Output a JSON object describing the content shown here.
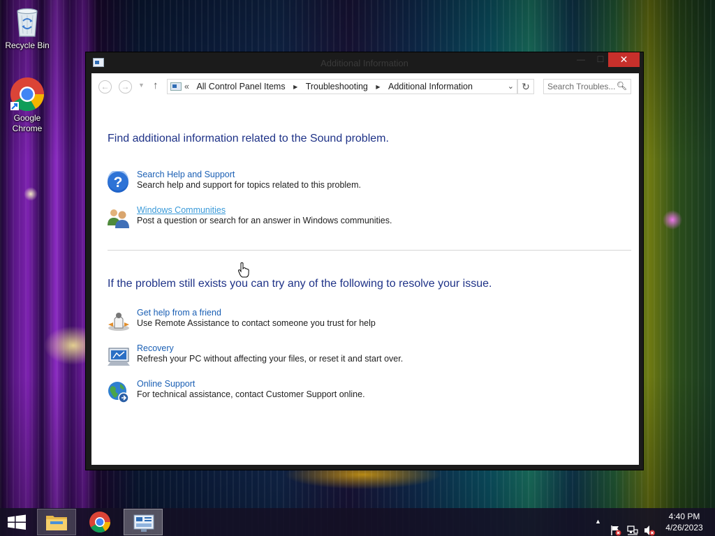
{
  "desktop": {
    "icons": [
      {
        "label": "Recycle Bin",
        "icon": "recycle-bin-icon"
      },
      {
        "label": "Google\nChrome",
        "icon": "chrome-icon"
      }
    ]
  },
  "window": {
    "title": "Additional Information",
    "close_glyph": "✕",
    "min_glyph": "—",
    "max_glyph": "☐"
  },
  "nav": {
    "back_glyph": "←",
    "forward_glyph": "→",
    "recent_glyph": "▼",
    "up_glyph": "↑",
    "lead": "«",
    "breadcrumbs": [
      "All Control Panel Items",
      "Troubleshooting",
      "Additional Information"
    ],
    "search_placeholder": "Search Troubles..."
  },
  "content": {
    "heading1": "Find additional information related to the Sound problem.",
    "heading2": "If the problem still exists you can try any of the following to resolve your issue.",
    "items": [
      {
        "link": "Search Help and Support",
        "desc": "Search help and support for topics related to this problem.",
        "icon": "help-question-icon"
      },
      {
        "link": "Windows Communities",
        "desc": "Post a question or search for an answer in Windows communities.",
        "icon": "communities-people-icon",
        "hovered": true
      },
      {
        "link": "Get help from a friend",
        "desc": "Use Remote Assistance to contact someone you trust for help",
        "icon": "remote-assistance-icon"
      },
      {
        "link": "Recovery",
        "desc": "Refresh your PC without affecting your files, or reset it and start over.",
        "icon": "recovery-icon"
      },
      {
        "link": "Online Support",
        "desc": "For technical assistance, contact Customer Support online.",
        "icon": "online-support-globe-icon"
      }
    ]
  },
  "taskbar": {
    "clock_time": "4:40 PM",
    "clock_date": "4/26/2023",
    "tray_up_glyph": "▲"
  },
  "colors": {
    "heading": "#1e3287",
    "link": "#1a5fb4",
    "link_hover": "#3a9ad9",
    "close_button": "#c7302b"
  }
}
